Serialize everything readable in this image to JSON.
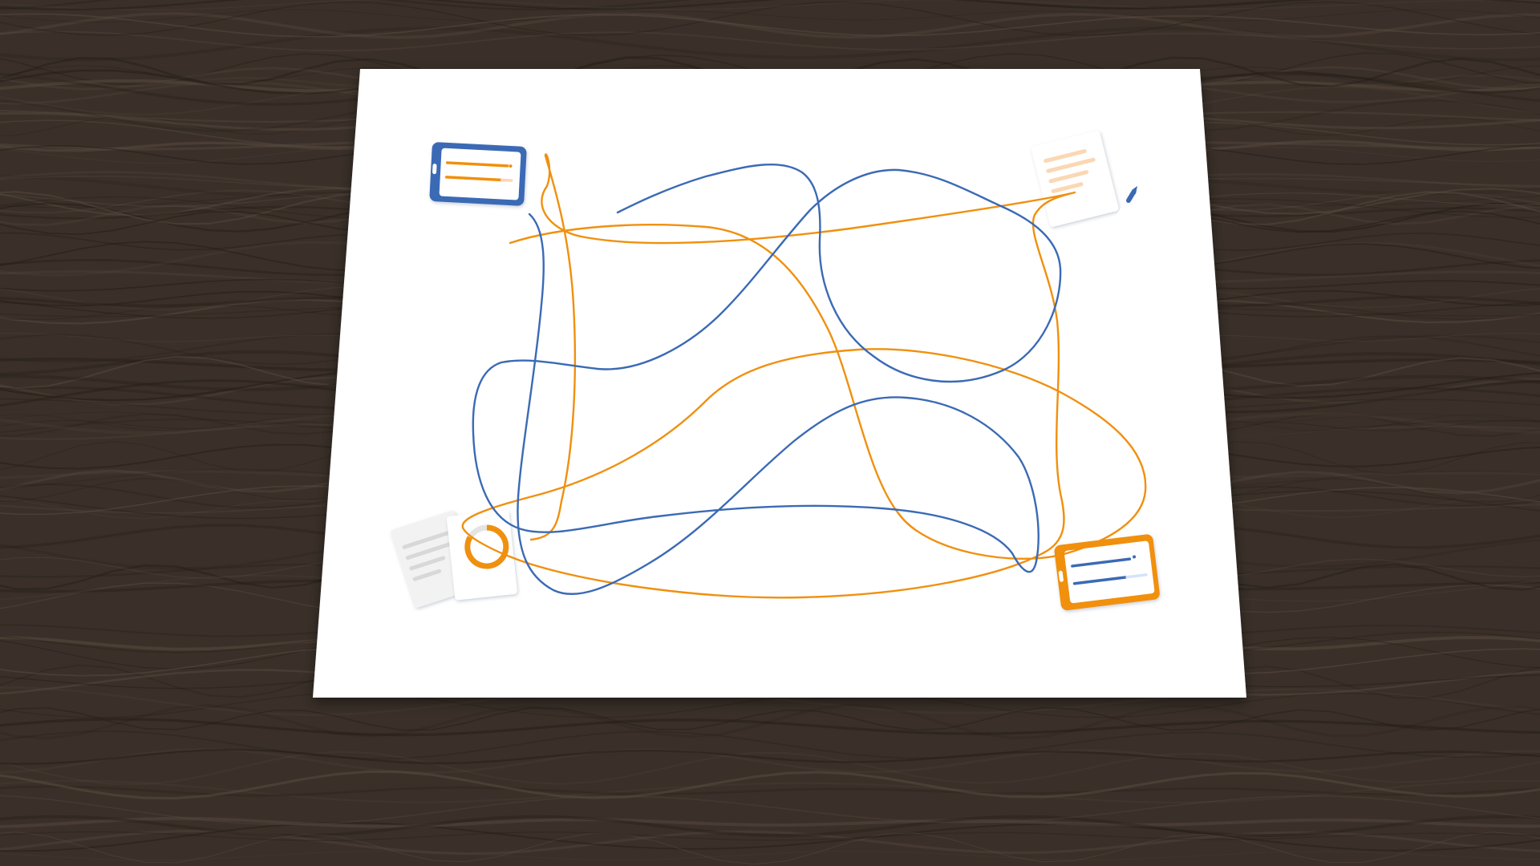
{
  "scene": {
    "description_free": true,
    "surface": {
      "material": "dark wood",
      "base_color": "#3a3029",
      "light_grain_color": "#5a4c42",
      "dark_grain_color": "#241c17"
    },
    "sheet": {
      "color": "#ffffff"
    },
    "panels": {
      "fill_color": "#deeafc",
      "items": [
        {
          "name": "top-left",
          "icon": "tablet-with-orange-lines-icon"
        },
        {
          "name": "top-right",
          "icon": "document-and-pen-icon"
        },
        {
          "name": "bottom-left",
          "icon": "documents-with-ring-chart-icon"
        },
        {
          "name": "bottom-right",
          "icon": "tablet-with-blue-lines-icon"
        }
      ]
    },
    "accent_colors": {
      "blue": "#3b6ab5",
      "orange": "#f0900f",
      "light_orange": "#fbd7b4",
      "light_gray": "#d8d8d8"
    },
    "paths": [
      {
        "name": "blue-tangled-path",
        "color_key": "blue"
      },
      {
        "name": "orange-tangled-path",
        "color_key": "orange"
      }
    ]
  }
}
